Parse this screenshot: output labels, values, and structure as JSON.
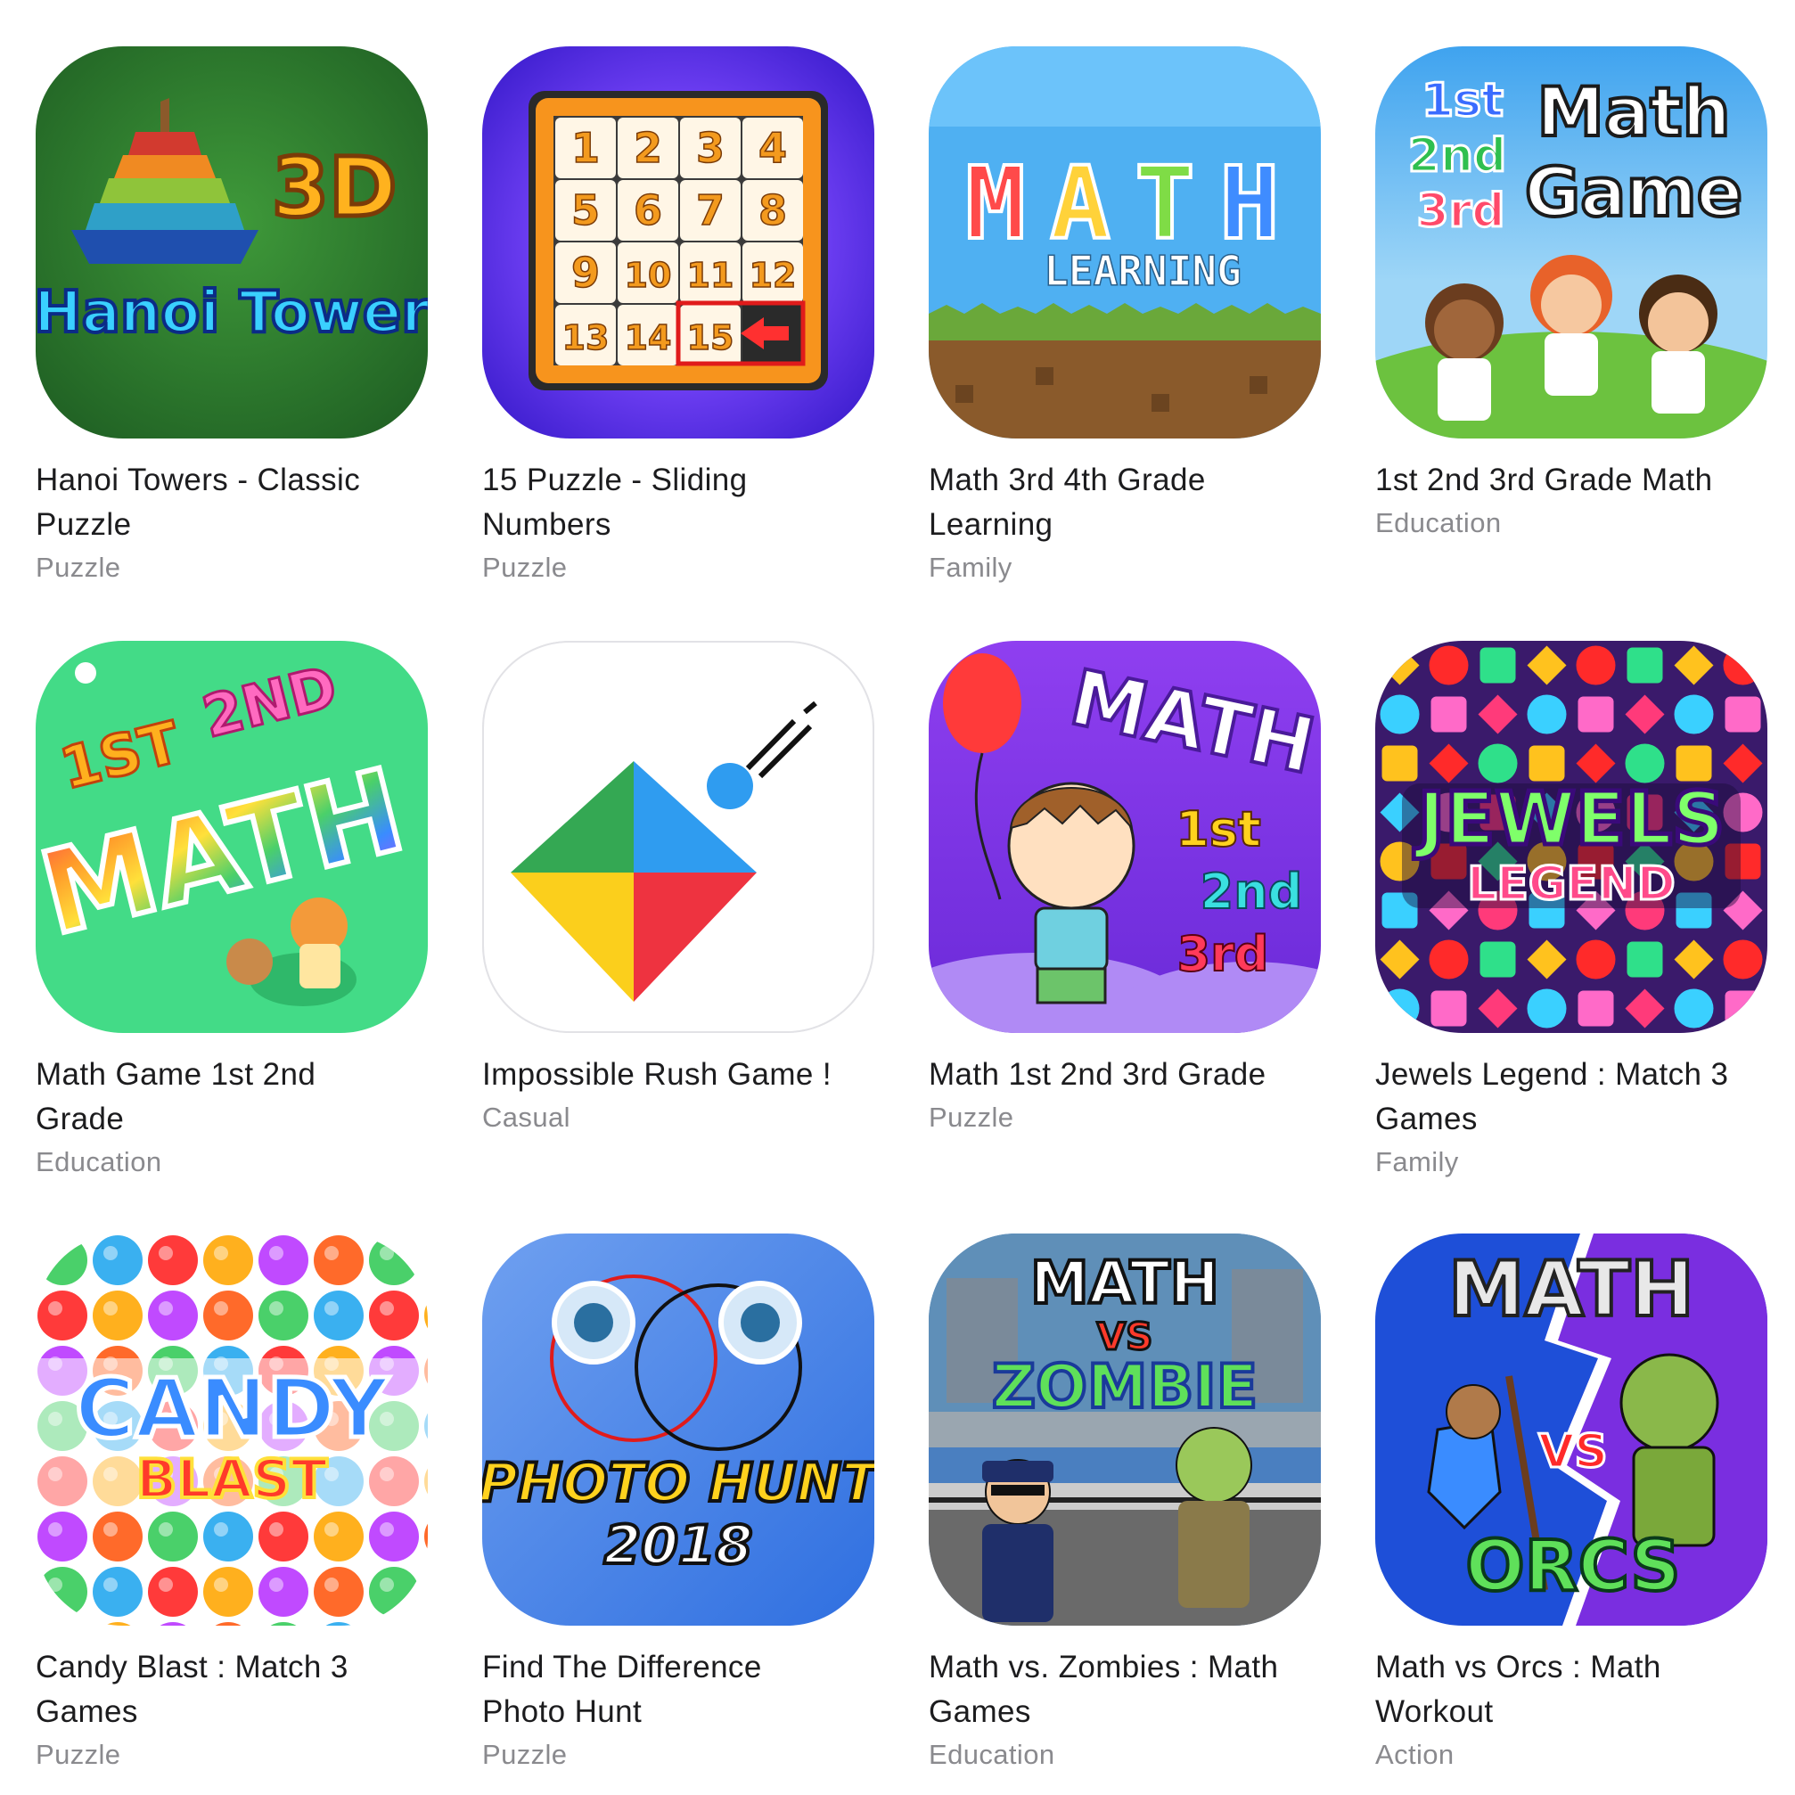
{
  "apps": [
    {
      "title_line1": "Hanoi Towers - Classic",
      "title_line2": "Puzzle",
      "category": "Puzzle",
      "icon": "hanoi-tower-3d-icon",
      "icon_text": [
        "3D",
        "Hanoi Tower"
      ],
      "accent": "#2e7d32"
    },
    {
      "title_line1": "15 Puzzle - Sliding",
      "title_line2": "Numbers",
      "category": "Puzzle",
      "icon": "sliding-15-puzzle-icon",
      "icon_text": [
        "1",
        "2",
        "3",
        "4",
        "5",
        "6",
        "7",
        "8",
        "9",
        "10",
        "11",
        "12",
        "13",
        "14",
        "15"
      ],
      "accent": "#5b34f0"
    },
    {
      "title_line1": "Math 3rd 4th Grade",
      "title_line2": "Learning",
      "category": "Family",
      "icon": "math-learning-pixel-icon",
      "icon_text": [
        "M",
        "A",
        "T",
        "H",
        "LEARNING"
      ],
      "accent": "#45a9f0"
    },
    {
      "title_line1": "1st 2nd 3rd Grade Math",
      "title_line2": "",
      "category": "Education",
      "icon": "math-game-kids-icon",
      "icon_text": [
        "1st",
        "2nd",
        "3rd",
        "Math",
        "Game"
      ],
      "accent": "#3aa5e8"
    },
    {
      "title_line1": "Math Game 1st 2nd",
      "title_line2": "Grade",
      "category": "Education",
      "icon": "rainbow-math-icon",
      "icon_text": [
        "1ST",
        "2ND",
        "MATH"
      ],
      "accent": "#3fdc86"
    },
    {
      "title_line1": "Impossible Rush Game !",
      "title_line2": "",
      "category": "Casual",
      "icon": "impossible-rush-diamond-icon",
      "icon_text": [],
      "accent": "#ffffff"
    },
    {
      "title_line1": "Math 1st 2nd 3rd Grade",
      "title_line2": "",
      "category": "Puzzle",
      "icon": "math-boy-balloon-icon",
      "icon_text": [
        "MATH",
        "1st",
        "2nd",
        "3rd"
      ],
      "accent": "#8a3ff0"
    },
    {
      "title_line1": "Jewels Legend : Match 3",
      "title_line2": "Games",
      "category": "Family",
      "icon": "jewels-legend-icon",
      "icon_text": [
        "JEWELS",
        "LEGEND"
      ],
      "accent": "#3a1a6b"
    },
    {
      "title_line1": "Candy Blast : Match 3",
      "title_line2": "Games",
      "category": "Puzzle",
      "icon": "candy-blast-icon",
      "icon_text": [
        "CANDY",
        "BLAST"
      ],
      "accent": "#ff4a4a"
    },
    {
      "title_line1": "Find The Difference",
      "title_line2": "Photo Hunt",
      "category": "Puzzle",
      "icon": "photo-hunt-icon",
      "icon_text": [
        "PHOTO HUNT",
        "2018"
      ],
      "accent": "#4a7bef"
    },
    {
      "title_line1": "Math vs. Zombies : Math",
      "title_line2": "Games",
      "category": "Education",
      "icon": "math-vs-zombie-icon",
      "icon_text": [
        "MATH",
        "VS",
        "ZOMBIE"
      ],
      "accent": "#2a6fc9"
    },
    {
      "title_line1": "Math vs Orcs : Math",
      "title_line2": "Workout",
      "category": "Action",
      "icon": "math-vs-orcs-icon",
      "icon_text": [
        "MATH",
        "VS",
        "ORCS"
      ],
      "accent": "#1e4fd8"
    }
  ]
}
